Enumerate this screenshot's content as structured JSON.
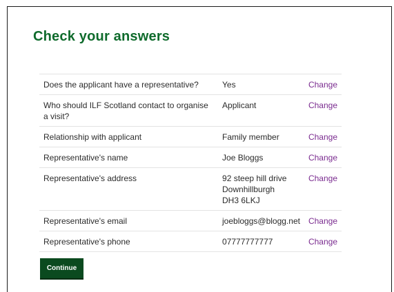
{
  "page": {
    "title": "Check your answers",
    "continue_label": "Continue"
  },
  "rows": [
    {
      "question": "Does the applicant have a representative?",
      "answer": [
        "Yes"
      ],
      "action": "Change"
    },
    {
      "question": "Who should ILF Scotland contact to organise a visit?",
      "answer": [
        "Applicant"
      ],
      "action": "Change"
    },
    {
      "question": "Relationship with applicant",
      "answer": [
        "Family member"
      ],
      "action": "Change"
    },
    {
      "question": "Representative's name",
      "answer": [
        "Joe Bloggs"
      ],
      "action": "Change"
    },
    {
      "question": "Representative's address",
      "answer": [
        "92 steep hill drive",
        "Downhillburgh",
        "DH3 6LKJ"
      ],
      "action": "Change"
    },
    {
      "question": "Representative's email",
      "answer": [
        "joebloggs@blogg.net"
      ],
      "action": "Change"
    },
    {
      "question": "Representative's phone",
      "answer": [
        "07777777777"
      ],
      "action": "Change"
    }
  ],
  "colors": {
    "heading": "#0f6b2c",
    "link": "#7a2b8f",
    "button": "#0b4a1f"
  }
}
